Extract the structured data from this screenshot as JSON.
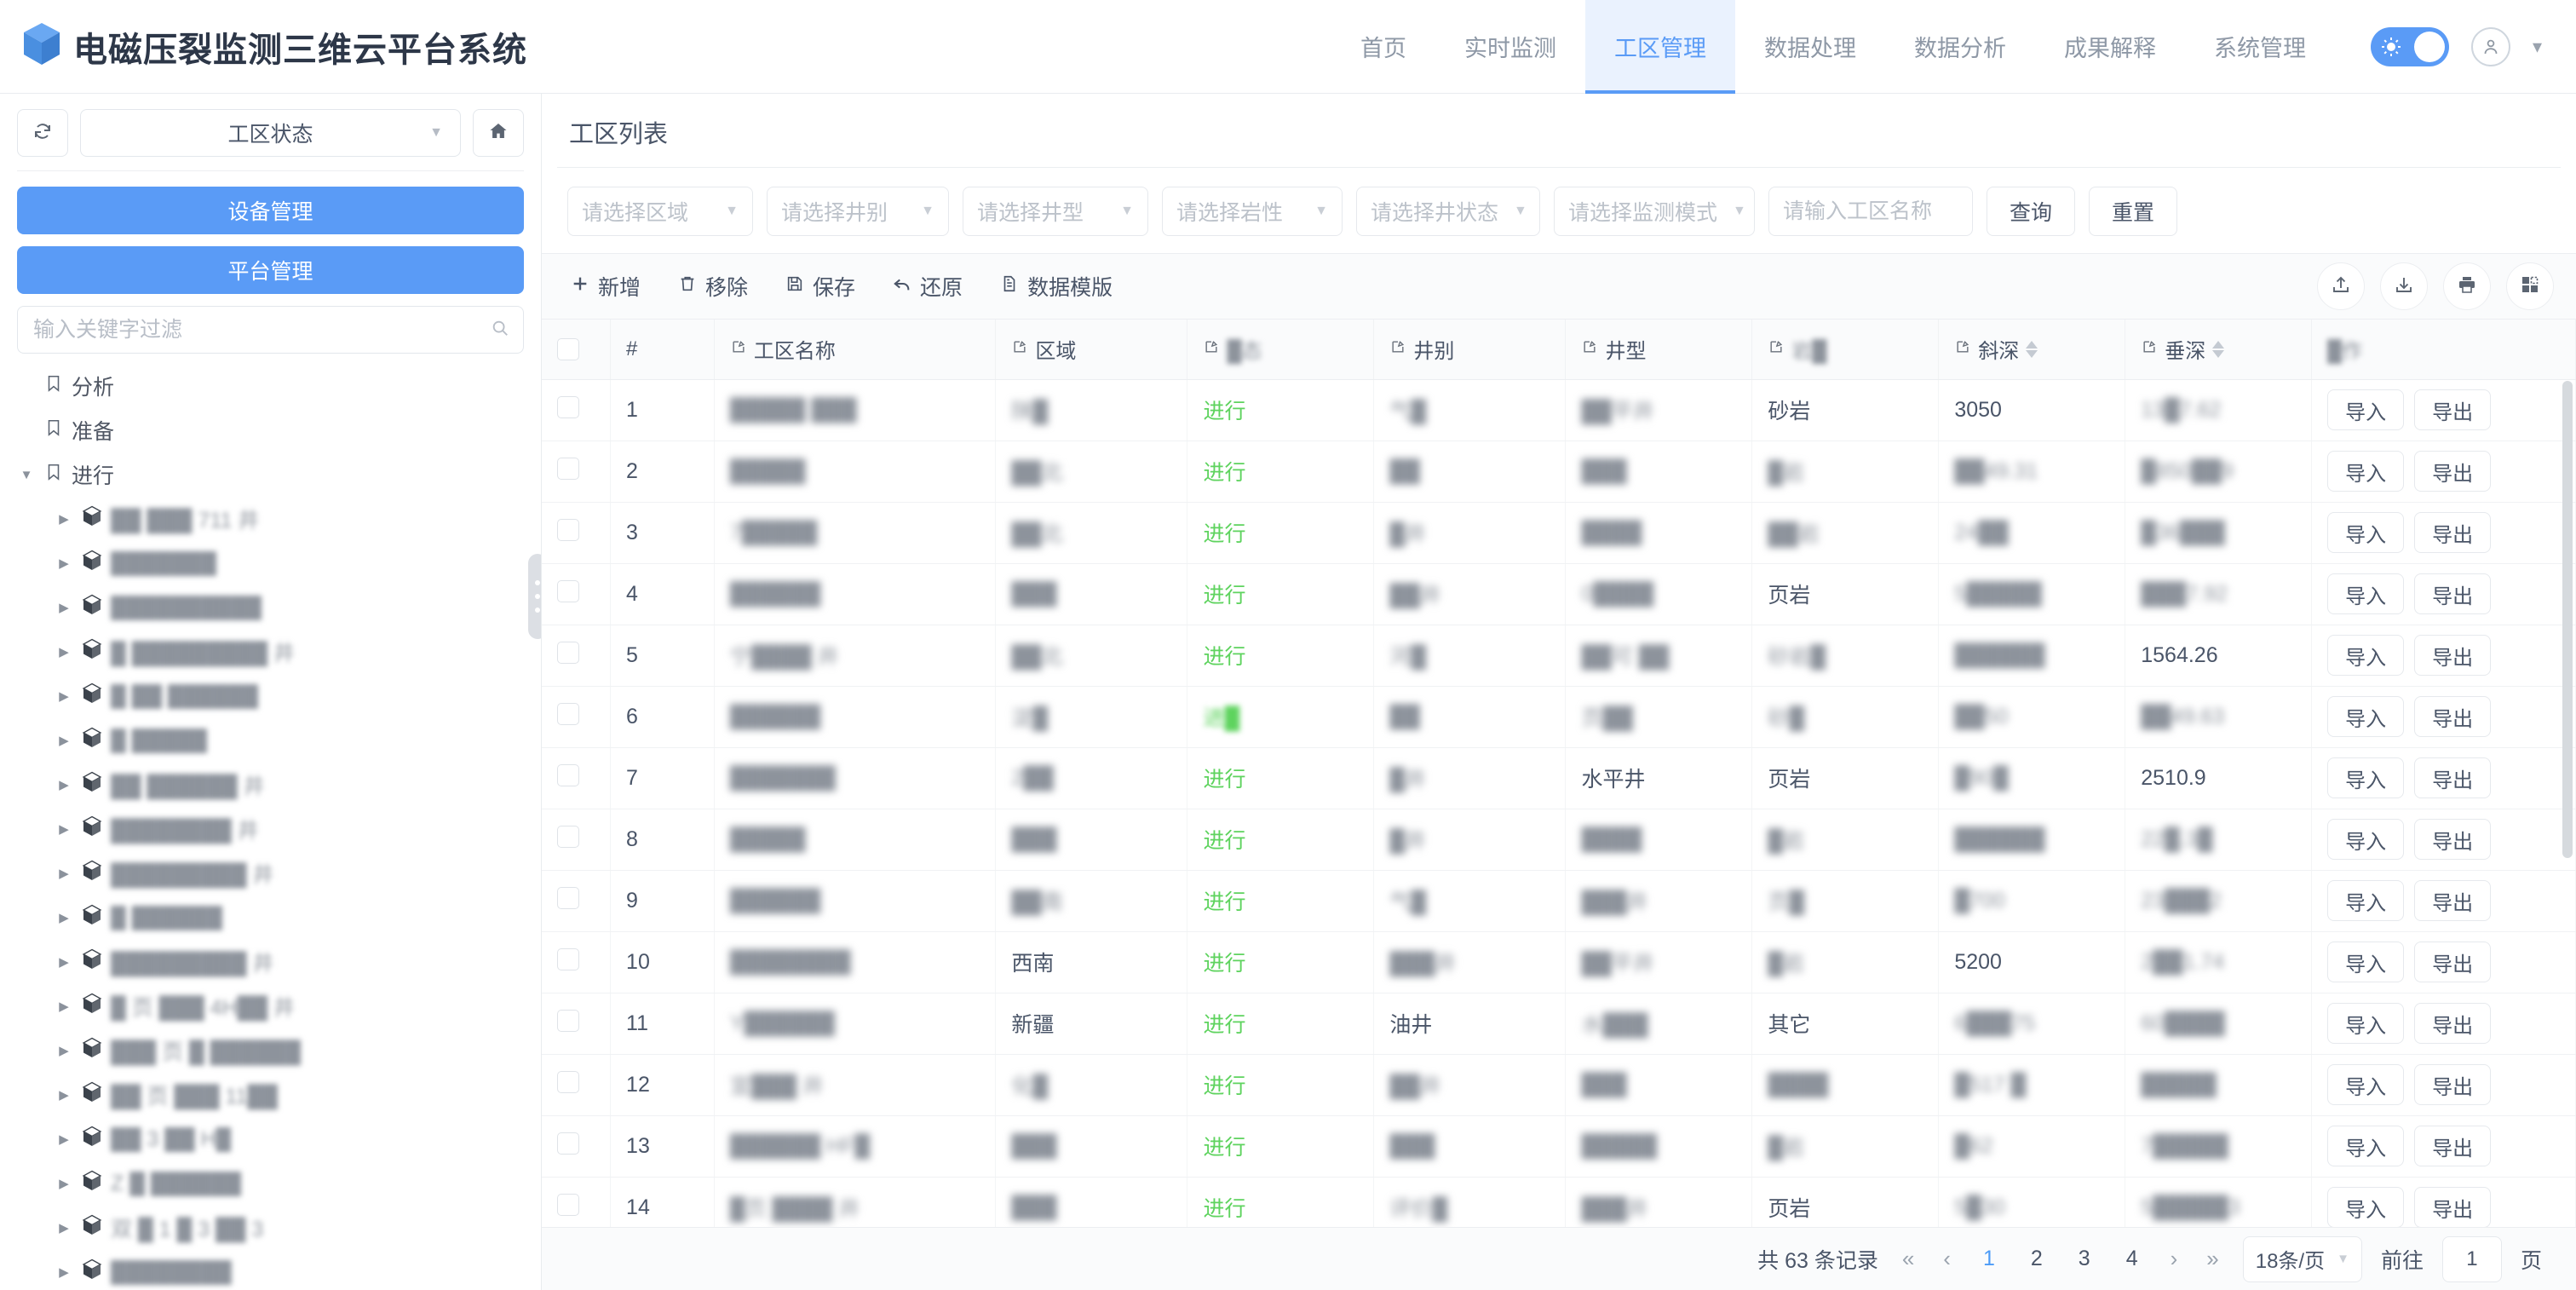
{
  "header": {
    "logo_icon": "cube-logo-icon",
    "title": "电磁压裂监测三维云平台系统",
    "nav": [
      {
        "label": "首页",
        "active": false
      },
      {
        "label": "实时监测",
        "active": false
      },
      {
        "label": "工区管理",
        "active": true
      },
      {
        "label": "数据处理",
        "active": false
      },
      {
        "label": "数据分析",
        "active": false
      },
      {
        "label": "成果解释",
        "active": false
      },
      {
        "label": "系统管理",
        "active": false
      }
    ],
    "theme_toggle_on": true,
    "accent_color": "#5a9bf6"
  },
  "sidebar": {
    "refresh_icon": "refresh-icon",
    "home_icon": "home-icon",
    "status_select": "工区状态",
    "buttons": [
      {
        "label": "设备管理"
      },
      {
        "label": "平台管理"
      }
    ],
    "filter_placeholder": "输入关键字过滤",
    "filter_value": "",
    "tree": [
      {
        "label": "分析",
        "icon": "flag-icon",
        "level": 0,
        "expanded": false,
        "blur": false,
        "has_arrow": false
      },
      {
        "label": "准备",
        "icon": "flag-icon",
        "level": 0,
        "expanded": false,
        "blur": false,
        "has_arrow": false
      },
      {
        "label": "进行",
        "icon": "flag-icon",
        "level": 0,
        "expanded": true,
        "blur": false,
        "has_arrow": true
      },
      {
        "label": "██ ███ 711 井",
        "icon": "cube-icon",
        "level": 1,
        "blur": true,
        "has_arrow": true
      },
      {
        "label": "███████",
        "icon": "cube-icon",
        "level": 1,
        "blur": true,
        "has_arrow": true
      },
      {
        "label": "██████████",
        "icon": "cube-icon",
        "level": 1,
        "blur": true,
        "has_arrow": true
      },
      {
        "label": "█ █████████ 井",
        "icon": "cube-icon",
        "level": 1,
        "blur": true,
        "has_arrow": true
      },
      {
        "label": "█ ██ ██████",
        "icon": "cube-icon",
        "level": 1,
        "blur": true,
        "has_arrow": true
      },
      {
        "label": "█ █████",
        "icon": "cube-icon",
        "level": 1,
        "blur": true,
        "has_arrow": true
      },
      {
        "label": "██ ██████ 井",
        "icon": "cube-icon",
        "level": 1,
        "blur": true,
        "has_arrow": true
      },
      {
        "label": "████████ 井",
        "icon": "cube-icon",
        "level": 1,
        "blur": true,
        "has_arrow": true
      },
      {
        "label": "█████████ 井",
        "icon": "cube-icon",
        "level": 1,
        "blur": true,
        "has_arrow": true
      },
      {
        "label": "█ ██████",
        "icon": "cube-icon",
        "level": 1,
        "blur": true,
        "has_arrow": true
      },
      {
        "label": "█████████ 井",
        "icon": "cube-icon",
        "level": 1,
        "blur": true,
        "has_arrow": true
      },
      {
        "label": "█ 页 ███ 4H██ 井",
        "icon": "cube-icon",
        "level": 1,
        "blur": true,
        "has_arrow": true
      },
      {
        "label": "███ 页 █ ██████",
        "icon": "cube-icon",
        "level": 1,
        "blur": true,
        "has_arrow": true
      },
      {
        "label": "██ 页 ███ 11██",
        "icon": "cube-icon",
        "level": 1,
        "blur": true,
        "has_arrow": true
      },
      {
        "label": "██ 3 ██ H█",
        "icon": "cube-icon",
        "level": 1,
        "blur": true,
        "has_arrow": true
      },
      {
        "label": "Z █ ██████",
        "icon": "cube-icon",
        "level": 1,
        "blur": true,
        "has_arrow": true
      },
      {
        "label": "双 █ 1 █ 3 ██ 3",
        "icon": "cube-icon",
        "level": 1,
        "blur": true,
        "has_arrow": true
      },
      {
        "label": "████████",
        "icon": "cube-icon",
        "level": 1,
        "blur": true,
        "has_arrow": true
      }
    ]
  },
  "main": {
    "title": "工区列表",
    "filters": {
      "region": "请选择区域",
      "well_class": "请选择井别",
      "well_type": "请选择井型",
      "lithology": "请选择岩性",
      "well_status": "请选择井状态",
      "monitor_mode": "请选择监测模式",
      "name_placeholder": "请输入工区名称",
      "name_value": "",
      "query_label": "查询",
      "reset_label": "重置"
    },
    "toolbar": {
      "items": [
        {
          "label": "新增",
          "icon": "plus-icon"
        },
        {
          "label": "移除",
          "icon": "trash-icon"
        },
        {
          "label": "保存",
          "icon": "save-icon"
        },
        {
          "label": "还原",
          "icon": "undo-icon"
        },
        {
          "label": "数据模版",
          "icon": "document-icon"
        }
      ],
      "right_icons": [
        {
          "name": "upload-icon"
        },
        {
          "name": "download-icon"
        },
        {
          "name": "print-icon"
        },
        {
          "name": "column-settings-icon"
        }
      ]
    },
    "table": {
      "columns": [
        {
          "label": "",
          "key": "check",
          "editable": false,
          "sortable": false
        },
        {
          "label": "#",
          "key": "index",
          "editable": false,
          "sortable": false
        },
        {
          "label": "工区名称",
          "key": "name",
          "editable": true,
          "sortable": false
        },
        {
          "label": "区域",
          "key": "region",
          "editable": true,
          "sortable": false
        },
        {
          "label": "█态",
          "key": "status",
          "editable": true,
          "sortable": false,
          "blur": true
        },
        {
          "label": "井别",
          "key": "well_class",
          "editable": true,
          "sortable": false
        },
        {
          "label": "井型",
          "key": "well_type",
          "editable": true,
          "sortable": false
        },
        {
          "label": "岩█",
          "key": "lithology",
          "editable": true,
          "sortable": false,
          "blur": true
        },
        {
          "label": "斜深",
          "key": "slant_depth",
          "editable": true,
          "sortable": true
        },
        {
          "label": "垂深",
          "key": "vertical_depth",
          "editable": true,
          "sortable": true
        },
        {
          "label": "█作",
          "key": "actions",
          "editable": false,
          "sortable": false,
          "blur": true
        }
      ],
      "action_labels": {
        "import": "导入",
        "export": "导出"
      },
      "status_color": "#5ed35e",
      "rows": [
        {
          "index": 1,
          "name": "█████ ███",
          "region": "陕█",
          "status": "进行",
          "well_class": "气█",
          "well_type": "██平井",
          "lithology": "砂岩",
          "slant_depth": "3050",
          "vertical_depth": "13█7.62"
        },
        {
          "index": 2,
          "name": "█████",
          "region": "██北",
          "status": "进行",
          "well_class": "██",
          "well_type": "███",
          "lithology": "█岩",
          "slant_depth": "██49.31",
          "vertical_depth": "█850██9"
        },
        {
          "index": 3,
          "name": "7█████",
          "region": "██北",
          "status": "进行",
          "well_class": "█井",
          "well_type": "████",
          "lithology": "██岩",
          "slant_depth": "24██",
          "vertical_depth": "█36███"
        },
        {
          "index": 4,
          "name": "██████",
          "region": "███",
          "status": "进行",
          "well_class": "██井",
          "well_type": "0████",
          "lithology": "页岩",
          "slant_depth": "5█████",
          "vertical_depth": "███7.92"
        },
        {
          "index": 5,
          "name": "宁████ 井",
          "region": "██北",
          "status": "进行",
          "well_class": "河█",
          "well_type": "██可 ██",
          "lithology": "砂岩█",
          "slant_depth": "██████",
          "vertical_depth": "1564.26"
        },
        {
          "index": 6,
          "name": "██████",
          "region": "淀█",
          "status": "进█",
          "well_class": "██",
          "well_type": "页██",
          "lithology": "砂█",
          "slant_depth": "██50",
          "vertical_depth": "██49.63"
        },
        {
          "index": 7,
          "name": "███████",
          "region": "2██",
          "status": "进行",
          "well_class": "█井",
          "well_type": "水平井",
          "lithology": "页岩",
          "slant_depth": "█90█",
          "vertical_depth": "2510.9"
        },
        {
          "index": 8,
          "name": "█████",
          "region": "███",
          "status": "进行",
          "well_class": "█井",
          "well_type": "████",
          "lithology": "█岩",
          "slant_depth": "██████",
          "vertical_depth": "22█.3█"
        },
        {
          "index": 9,
          "name": "██████",
          "region": "██南",
          "status": "进行",
          "well_class": "气█",
          "well_type": "███井",
          "lithology": "页█",
          "slant_depth": "█700",
          "vertical_depth": "23███2"
        },
        {
          "index": 10,
          "name": "████████",
          "region": "西南",
          "status": "进行",
          "well_class": "███井",
          "well_type": "██平井",
          "lithology": "█岩",
          "slant_depth": "5200",
          "vertical_depth": "2██1.74"
        },
        {
          "index": 11,
          "name": "Y██████",
          "region": "新疆",
          "status": "进行",
          "well_class": "油井",
          "well_type": "水███",
          "lithology": "其它",
          "slant_depth": "6███75",
          "vertical_depth": "60████"
        },
        {
          "index": 12,
          "name": "宣███ 井",
          "region": "化█",
          "status": "进行",
          "well_class": "██井",
          "well_type": "███",
          "lithology": "████",
          "slant_depth": "█517 █",
          "vertical_depth": "█████"
        },
        {
          "index": 13,
          "name": "██████ HF█",
          "region": "███",
          "status": "进行",
          "well_class": "███",
          "well_type": "█████",
          "lithology": "█岩",
          "slant_depth": "█62",
          "vertical_depth": "7█████"
        },
        {
          "index": 14,
          "name": "█页 ████ 井",
          "region": "███",
          "status": "进行",
          "well_class": "评价█",
          "well_type": "███井",
          "lithology": "页岩",
          "slant_depth": "5█30",
          "vertical_depth": "5█████3"
        }
      ]
    },
    "pagination": {
      "total_text": "共 63 条记录",
      "first_icon": "«",
      "prev_icon": "‹",
      "pages": [
        "1",
        "2",
        "3",
        "4"
      ],
      "current_page": "1",
      "next_icon": "›",
      "last_icon": "»",
      "page_size": "18条/页",
      "goto_label": "前往",
      "goto_value": "1",
      "page_unit": "页"
    }
  }
}
